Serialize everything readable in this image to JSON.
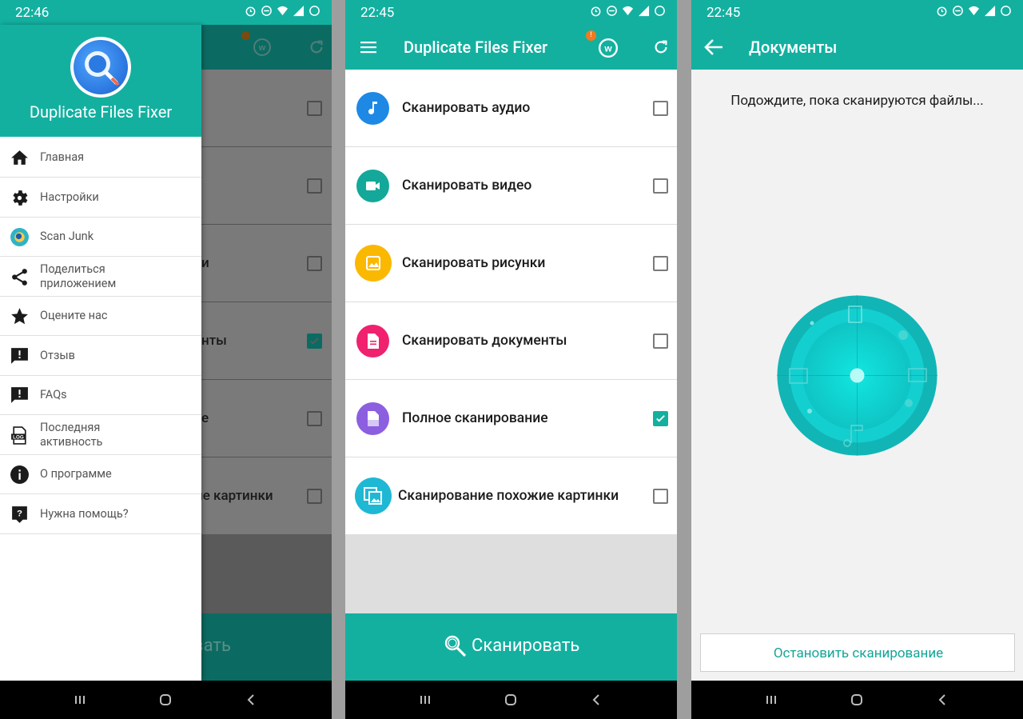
{
  "screen1": {
    "status_time": "22:46",
    "drawer": {
      "app_title": "Duplicate Files Fixer",
      "items": [
        {
          "label": "Главная",
          "icon": "home-icon"
        },
        {
          "label": "Настройки",
          "icon": "gear-icon"
        },
        {
          "label": "Scan Junk",
          "icon": "scan-junk-icon"
        },
        {
          "label": "Поделиться приложением",
          "line1": "Поделиться",
          "line2": "приложением",
          "icon": "share-icon"
        },
        {
          "label": "Оцените нас",
          "icon": "star-icon"
        },
        {
          "label": "Отзыв",
          "icon": "feedback-icon"
        },
        {
          "label": "FAQs",
          "icon": "faq-icon"
        },
        {
          "label": "Последняя активность",
          "line1": "Последняя",
          "line2": "активность",
          "icon": "log-icon"
        },
        {
          "label": "О программе",
          "icon": "info-icon"
        },
        {
          "label": "Нужна помощь?",
          "icon": "help-icon"
        }
      ]
    },
    "behind": {
      "row_fragments": [
        "",
        "",
        "и",
        "нты",
        "е",
        "ие картинки"
      ],
      "button_fragment": "вать"
    }
  },
  "screen2": {
    "status_time": "22:45",
    "title": "Duplicate Files Fixer",
    "badge": "!",
    "rows": [
      {
        "label": "Сканировать аудио",
        "icon": "music-icon",
        "color": "#1e88e5",
        "checked": false
      },
      {
        "label": "Сканировать видео",
        "icon": "video-icon",
        "color": "#13a89a",
        "checked": false
      },
      {
        "label": "Сканировать рисунки",
        "icon": "image-icon",
        "color": "#fbb800",
        "checked": false
      },
      {
        "label": "Сканировать документы",
        "icon": "document-icon",
        "color": "#f0216e",
        "checked": false
      },
      {
        "label": "Полное сканирование",
        "icon": "full-scan-icon",
        "color": "#8c5ee0",
        "checked": true
      },
      {
        "label": "Сканирование похожие картинки",
        "icon": "similar-images-icon",
        "color": "#1fb8d4",
        "checked": false
      }
    ],
    "scan_button": "Сканировать"
  },
  "screen3": {
    "status_time": "22:45",
    "title": "Документы",
    "message": "Подождите, пока сканируются файлы...",
    "stop_button": "Остановить сканирование"
  },
  "colors": {
    "accent": "#13b0a0",
    "dark_accent": "#0b6b62"
  }
}
